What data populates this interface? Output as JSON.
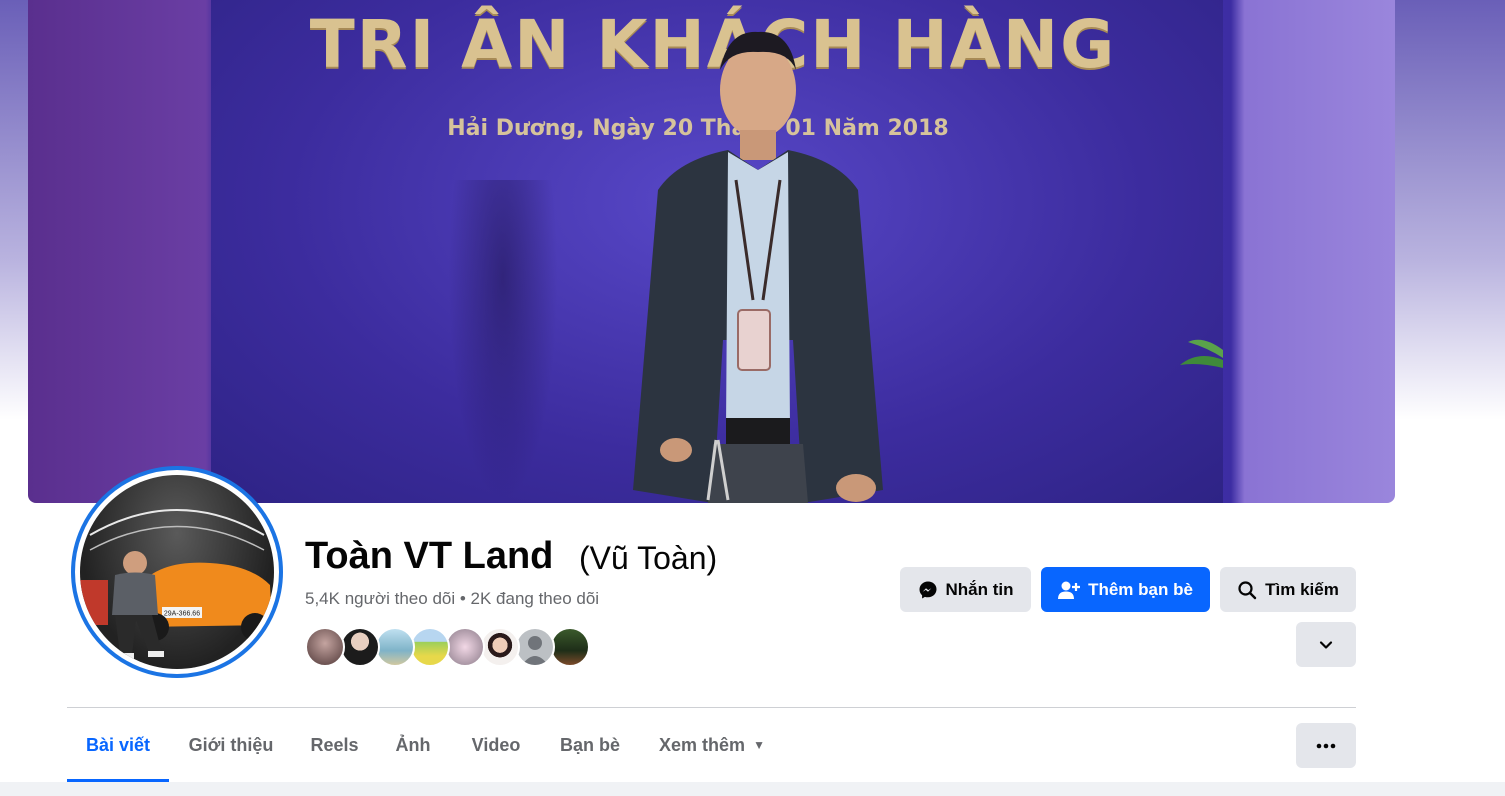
{
  "cover": {
    "title": "TRI ÂN KHÁCH HÀNG",
    "subtitle": "Hải Dương, Ngày 20 Tháng 01 Năm 2018"
  },
  "profile": {
    "name": "Toàn VT Land",
    "alternate_name": "(Vũ Toàn)",
    "follow_stats": "5,4K người theo dõi • 2K đang theo dõi",
    "avatar_plate": "29A-366.66",
    "friend_avatar_count": 8
  },
  "actions": {
    "message": "Nhắn tin",
    "add_friend": "Thêm bạn bè",
    "search": "Tìm kiếm",
    "more_icon": "chevron-down-icon",
    "options_icon": "more-horizontal-icon"
  },
  "tabs": [
    {
      "label": "Bài viết",
      "active": true
    },
    {
      "label": "Giới thiệu",
      "active": false
    },
    {
      "label": "Reels",
      "active": false
    },
    {
      "label": "Ảnh",
      "active": false
    },
    {
      "label": "Video",
      "active": false
    },
    {
      "label": "Bạn bè",
      "active": false
    },
    {
      "label": "Xem thêm",
      "active": false
    }
  ],
  "colors": {
    "accent": "#0866ff",
    "avatar_ring": "#1b74e4",
    "button_gray": "#e4e6eb",
    "secondary_text": "#65676b"
  }
}
